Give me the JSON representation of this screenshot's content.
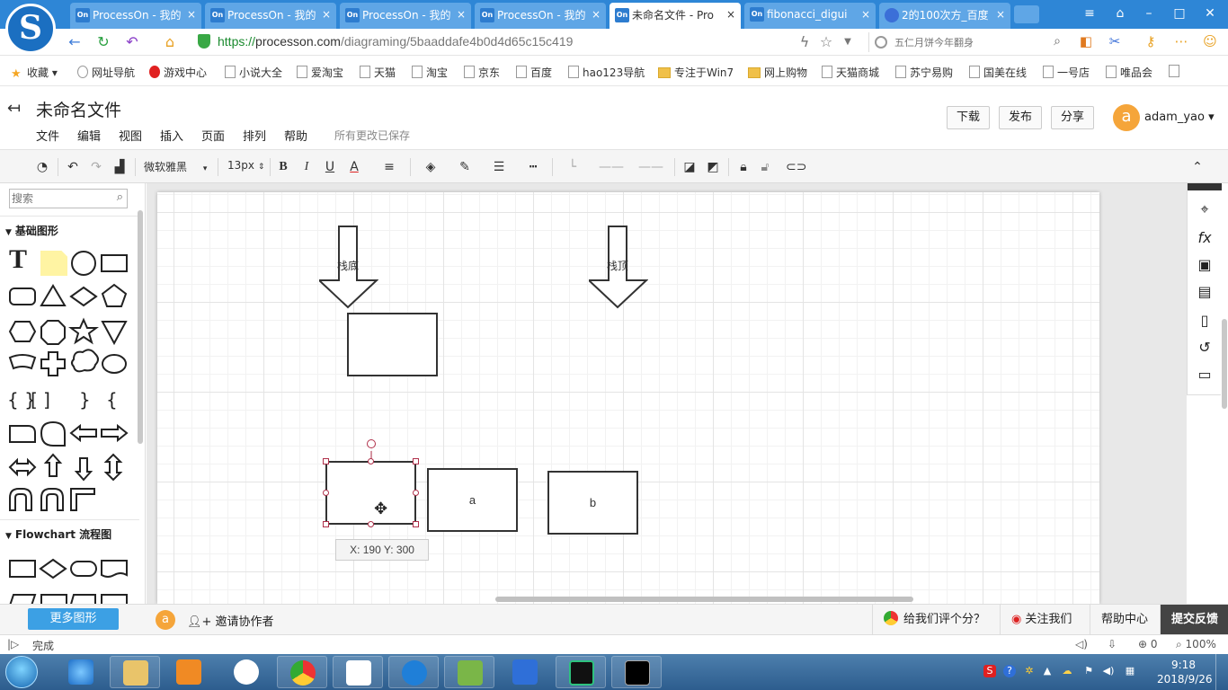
{
  "browser": {
    "tabs": [
      {
        "favicon": "On",
        "title": "ProcessOn - 我的",
        "active": false
      },
      {
        "favicon": "On",
        "title": "ProcessOn - 我的",
        "active": false
      },
      {
        "favicon": "On",
        "title": "ProcessOn - 我的",
        "active": false
      },
      {
        "favicon": "On",
        "title": "ProcessOn - 我的",
        "active": false
      },
      {
        "favicon": "On",
        "title": "未命名文件 - Pro",
        "active": true
      },
      {
        "favicon": "On",
        "title": "fibonacci_digui",
        "active": false
      },
      {
        "favicon": "paw",
        "title": "2的100次方_百度",
        "active": false
      }
    ],
    "tab_close": "×",
    "url_scheme": "https://",
    "url_host": "processon.com",
    "url_path": "/diagraming/5baaddafe4b0d4d65c15c419",
    "search_placeholder": "五仁月饼今年翻身",
    "bookmarks": [
      {
        "label": "收藏",
        "icon": "star"
      },
      {
        "label": "网址导航",
        "icon": "globe"
      },
      {
        "label": "游戏中心",
        "icon": "red"
      },
      {
        "label": "小说大全",
        "icon": "page"
      },
      {
        "label": "爱淘宝",
        "icon": "page"
      },
      {
        "label": "天猫",
        "icon": "page"
      },
      {
        "label": "淘宝",
        "icon": "page"
      },
      {
        "label": "京东",
        "icon": "page"
      },
      {
        "label": "百度",
        "icon": "page"
      },
      {
        "label": "hao123导航",
        "icon": "page"
      },
      {
        "label": "专注于Win7",
        "icon": "folder"
      },
      {
        "label": "网上购物",
        "icon": "folder"
      },
      {
        "label": "天猫商城",
        "icon": "page"
      },
      {
        "label": "苏宁易购",
        "icon": "page"
      },
      {
        "label": "国美在线",
        "icon": "page"
      },
      {
        "label": "一号店",
        "icon": "page"
      },
      {
        "label": "唯品会",
        "icon": "page"
      }
    ],
    "status_text": "完成",
    "zoom": "100%",
    "download_count": "0"
  },
  "app": {
    "doc_title": "未命名文件",
    "menus": [
      "文件",
      "编辑",
      "视图",
      "插入",
      "页面",
      "排列",
      "帮助"
    ],
    "save_status": "所有更改已保存",
    "buttons": {
      "download": "下载",
      "publish": "发布",
      "share": "分享"
    },
    "avatar_letter": "a",
    "username": "adam_yao",
    "toolbar": {
      "font": "微软雅黑",
      "font_size": "13px",
      "bold": "B",
      "italic": "I",
      "underline": "U",
      "text_color": "A"
    }
  },
  "left_panel": {
    "search_placeholder": "搜索",
    "categories": [
      "基础图形",
      "Flowchart 流程图"
    ],
    "more_shapes": "更多图形"
  },
  "canvas": {
    "arrow_labels": [
      "栈底",
      "栈顶"
    ],
    "nodes": [
      {
        "id": "node-top",
        "label": ""
      },
      {
        "id": "node-selected",
        "label": ""
      },
      {
        "id": "node-a",
        "label": "a"
      },
      {
        "id": "node-b",
        "label": "b"
      }
    ],
    "coord_tip": "X: 190  Y: 300"
  },
  "bottom": {
    "avatar_letter": "a",
    "invite": "邀请协作者",
    "rate": "给我们评个分？",
    "follow": "关注我们",
    "help": "帮助中心",
    "feedback": "提交反馈"
  },
  "taskbar": {
    "time": "9:18",
    "date": "2018/9/26"
  },
  "colors": {
    "tab_bar": "#2e86d6",
    "accent_button": "#3ca0e4",
    "selection_handle": "#b0304a",
    "avatar": "#f5a53a"
  }
}
